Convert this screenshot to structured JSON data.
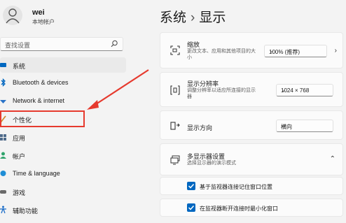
{
  "user": {
    "name": "wei",
    "account_type": "本地帐户"
  },
  "search": {
    "placeholder": "查找设置"
  },
  "nav": [
    {
      "label": "系统",
      "icon": "system-icon",
      "color": "#0067c0"
    },
    {
      "label": "Bluetooth & devices",
      "icon": "bluetooth-icon",
      "color": "#0067c0"
    },
    {
      "label": "Network & internet",
      "icon": "network-icon",
      "color": "#2a73c8"
    },
    {
      "label": "个性化",
      "icon": "brush-icon",
      "color": "#d08a2e"
    },
    {
      "label": "应用",
      "icon": "apps-icon",
      "color": "#4e6a8a"
    },
    {
      "label": "帐户",
      "icon": "account-icon",
      "color": "#2fa36b"
    },
    {
      "label": "Time & language",
      "icon": "globe-clock-icon",
      "color": "#1f8ed6"
    },
    {
      "label": "游戏",
      "icon": "gaming-icon",
      "color": "#6a6a6a"
    },
    {
      "label": "辅助功能",
      "icon": "accessibility-icon",
      "color": "#1f6fc8"
    }
  ],
  "breadcrumb": {
    "parent": "系统",
    "separator": "›",
    "current": "显示"
  },
  "scale": {
    "title": "缩放",
    "desc": "更改文本、应用和其他项目的大小",
    "value": "100% (推荐)"
  },
  "resolution": {
    "title": "显示分辨率",
    "desc": "调整分辨率以适应所连接的显示器",
    "value": "1024 × 768"
  },
  "orientation": {
    "title": "显示方向",
    "value": "横向"
  },
  "multi": {
    "title": "多显示器设置",
    "desc": "选择显示器的演示模式"
  },
  "options": [
    {
      "label": "基于监视器连接记住窗口位置",
      "checked": true
    },
    {
      "label": "在监视器断开连接时最小化窗口",
      "checked": true
    }
  ],
  "colors": {
    "accent": "#0067c0",
    "annotation": "#e63a2e"
  }
}
